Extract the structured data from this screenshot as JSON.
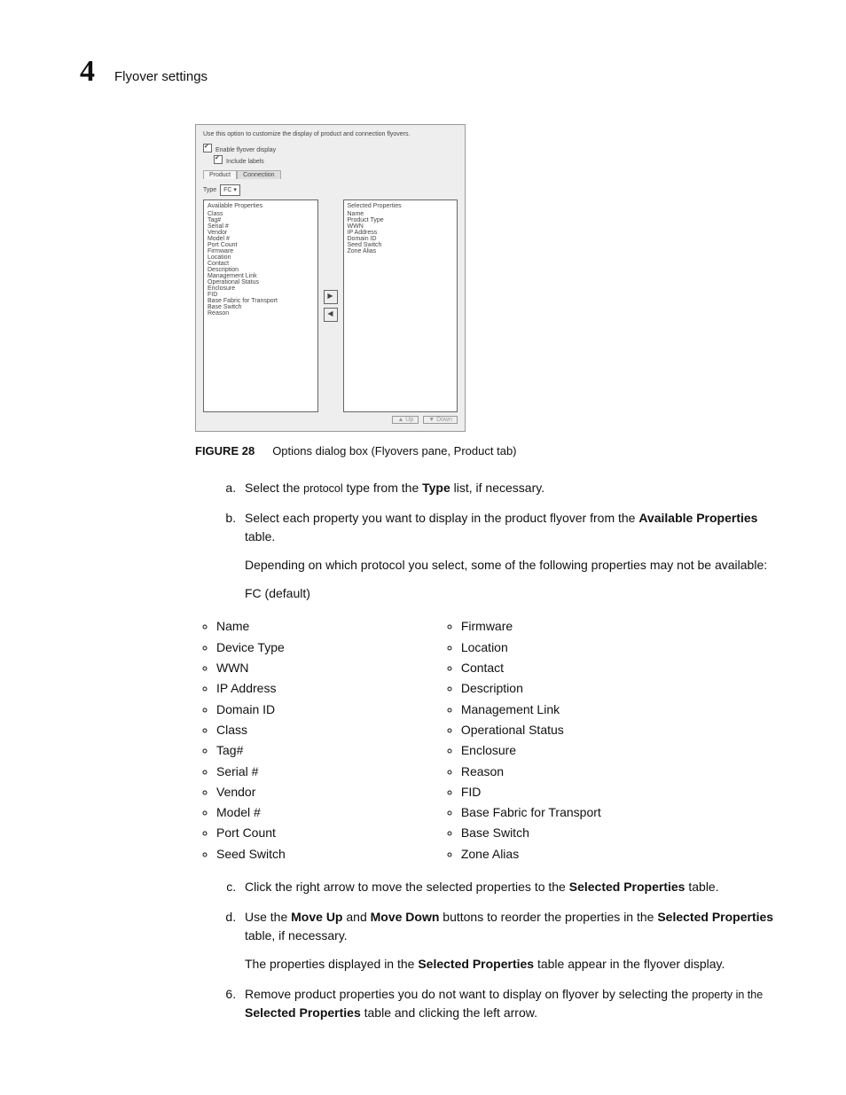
{
  "header": {
    "chapter": "4",
    "title": "Flyover settings"
  },
  "screenshot": {
    "intro": "Use this option to customize the display of product and connection flyovers.",
    "enable": "Enable flyover display",
    "include": "Include labels",
    "tab_product": "Product",
    "tab_connection": "Connection",
    "type_label": "Type",
    "type_value": "FC ▾",
    "avail_head": "Available Properties",
    "sel_head": "Selected Properties",
    "avail": [
      "Class",
      "Tag#",
      "Serial #",
      "Vendor",
      "Model #",
      "Port Count",
      "Firmware",
      "Location",
      "Contact",
      "Description",
      "Management Link",
      "Operational Status",
      "Enclosure",
      "FID",
      "Base Fabric for Transport",
      "Base Switch",
      "Reason"
    ],
    "sel": [
      "Name",
      "Product Type",
      "WWN",
      "IP Address",
      "Domain ID",
      "Seed Switch",
      "Zone Alias"
    ],
    "btn_up": "▲ Up",
    "btn_down": "▼ Down"
  },
  "fig": {
    "label": "FIGURE 28",
    "caption": "Options dialog box (Flyovers pane, Product tab)"
  },
  "steps": {
    "a": {
      "pre": "Select the ",
      "small": "protocol",
      "post": " type from the ",
      "bold": "Type",
      "tail": " list, if necessary."
    },
    "b": {
      "t1": "Select each property you want to display in the product flyover from the ",
      "bold1": "Available Properties",
      "t2": " table.",
      "para": "Depending on which protocol you select, some of the following properties may not be available:",
      "fc": "FC (default)"
    },
    "c": {
      "t1": "Click the right arrow to move the selected properties to the ",
      "bold1": "Selected Properties",
      "t2": " table."
    },
    "d": {
      "t1": "Use the ",
      "b1": "Move Up",
      "t2": " and ",
      "b2": "Move Down",
      "t3": " buttons to reorder the properties in the ",
      "b3": "Selected Properties",
      "t4": " table, if necessary.",
      "para_a": "The properties displayed in the ",
      "para_b": "Selected Properties",
      "para_c": " table appear in the flyover display."
    },
    "six": {
      "t1": "Remove product properties you do not want to display on flyover by selecting the ",
      "small": "property in the ",
      "b1": "Selected Properties",
      "t2": " table and clicking the left arrow."
    }
  },
  "bullets": {
    "left": [
      "Name",
      "Device Type",
      "WWN",
      "IP Address",
      "Domain ID",
      "Class",
      "Tag#",
      "Serial #",
      "Vendor",
      "Model #",
      "Port Count",
      "Seed Switch"
    ],
    "right": [
      "Firmware",
      "Location",
      "Contact",
      "Description",
      "Management Link",
      "Operational Status",
      "Enclosure",
      "Reason",
      "FID",
      "Base Fabric for Transport",
      "Base Switch",
      "Zone Alias"
    ]
  }
}
